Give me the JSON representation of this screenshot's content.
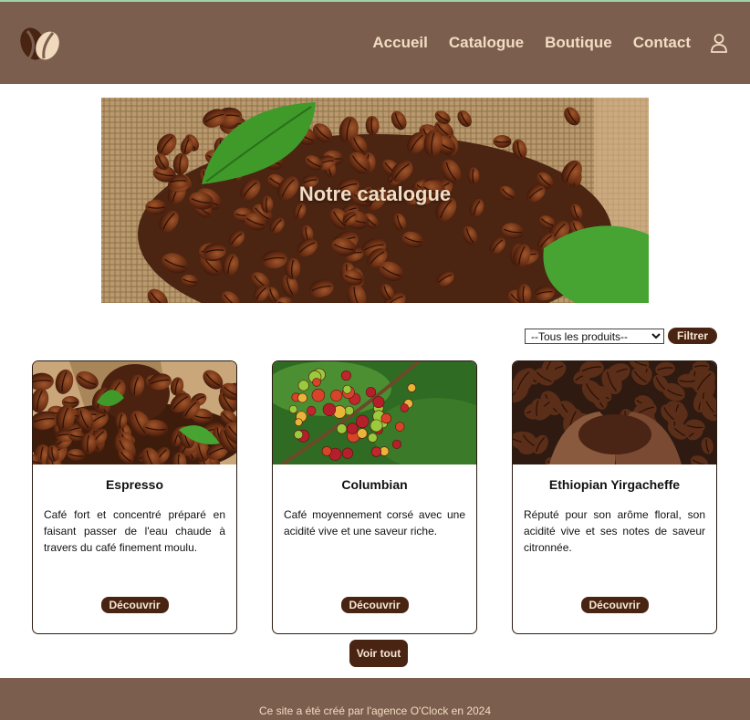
{
  "header": {
    "logo_icon": "coffee-bean-icon",
    "nav": [
      {
        "label": "Accueil"
      },
      {
        "label": "Catalogue"
      },
      {
        "label": "Boutique"
      },
      {
        "label": "Contact"
      }
    ],
    "user_icon": "user-icon"
  },
  "hero": {
    "title": "Notre catalogue"
  },
  "filter": {
    "selected_option": "--Tous les produits--",
    "button_label": "Filtrer"
  },
  "products": [
    {
      "name": "Espresso",
      "description": "Café fort et concentré préparé en faisant passer de l'eau chaude à travers du café finement moulu.",
      "button_label": "Découvrir"
    },
    {
      "name": "Columbian",
      "description": "Café moyennement corsé avec une acidité vive et une saveur riche.",
      "button_label": "Découvrir"
    },
    {
      "name": "Ethiopian Yirgacheffe",
      "description": "Réputé pour son arôme floral, son acidité vive et ses notes de saveur citronnée.",
      "button_label": "Découvrir"
    }
  ],
  "see_all_label": "Voir tout",
  "footer": {
    "text": "Ce site a été créé par l'agence O'Clock en 2024"
  },
  "colors": {
    "header_bg": "#7b5e4d",
    "nav_text": "#f2dcc4",
    "button_bg": "#4a2412",
    "button_text": "#f5e6d4"
  }
}
